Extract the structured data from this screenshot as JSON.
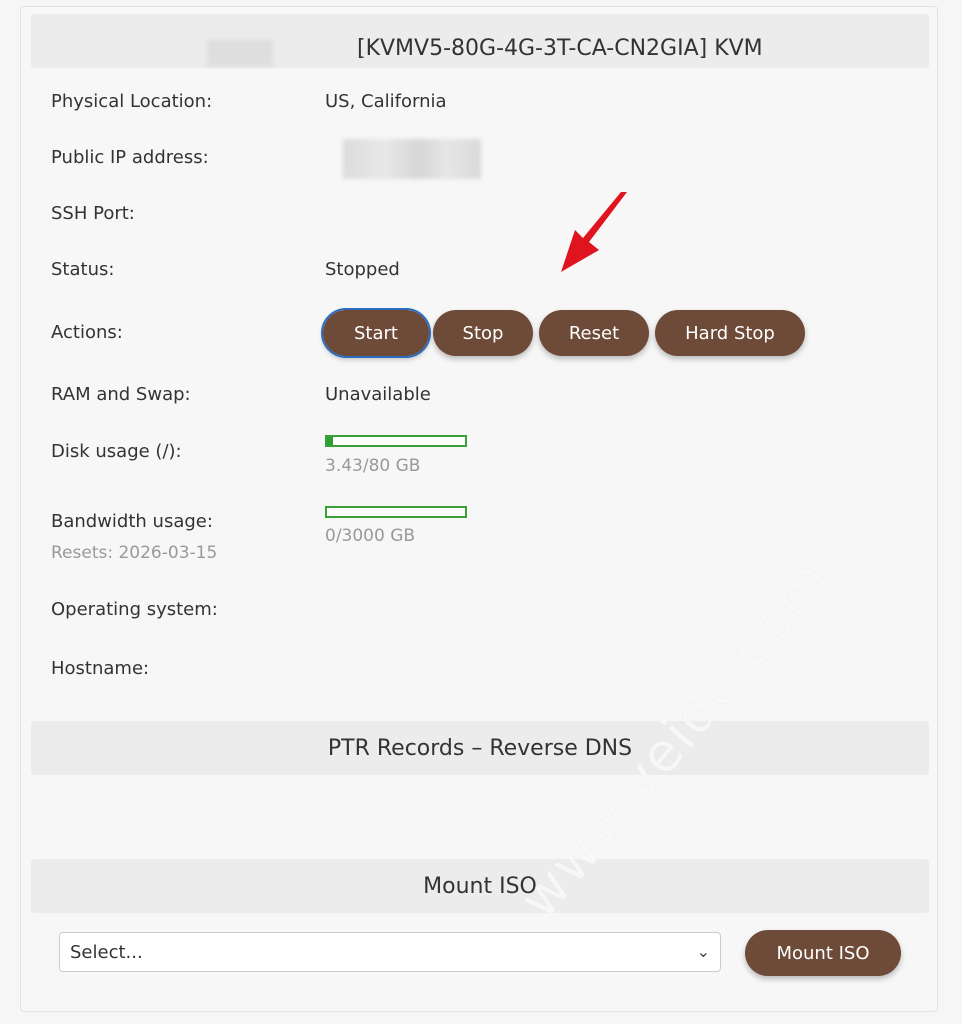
{
  "server": {
    "title": "[KVMV5-80G-4G-3T-CA-CN2GIA]  KVM"
  },
  "details": {
    "physical_location_label": "Physical Location:",
    "physical_location_value": "US, California",
    "public_ip_label": "Public IP address:",
    "ssh_port_label": "SSH Port:",
    "status_label": "Status:",
    "status_value": "Stopped",
    "actions_label": "Actions:",
    "ram_label": "RAM and Swap:",
    "ram_value": "Unavailable",
    "disk_label": "Disk usage (/):",
    "disk_value": "3.43/80 GB",
    "disk_fraction": 0.043,
    "bandwidth_label": "Bandwidth usage:",
    "bandwidth_resets": "Resets: 2026-03-15",
    "bandwidth_value": "0/3000 GB",
    "bandwidth_fraction": 0.0,
    "os_label": "Operating system:",
    "hostname_label": "Hostname:"
  },
  "actions": {
    "start": "Start",
    "stop": "Stop",
    "reset": "Reset",
    "hard_stop": "Hard Stop"
  },
  "ptr": {
    "heading": "PTR Records – Reverse DNS"
  },
  "mount_iso": {
    "heading": "Mount ISO",
    "select_value": "Select...",
    "button": "Mount ISO"
  },
  "watermark": "www.veidc.com",
  "colors": {
    "button_bg": "#6e4a38",
    "progress_green": "#2e9e2e",
    "arrow_red": "#e0141e",
    "focus_outline": "#2d6cc0"
  }
}
